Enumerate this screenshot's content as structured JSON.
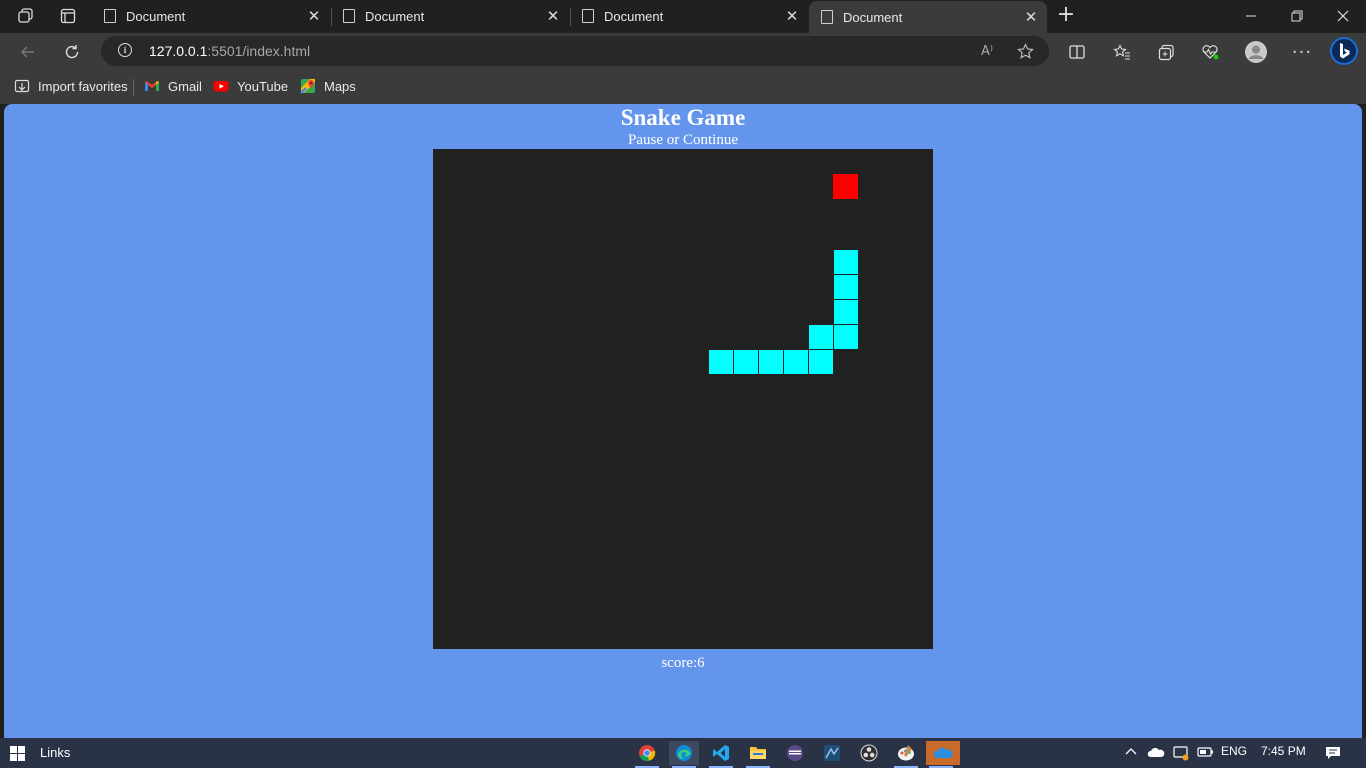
{
  "browser": {
    "tabs": [
      {
        "title": "Document",
        "active": false
      },
      {
        "title": "Document",
        "active": false
      },
      {
        "title": "Document",
        "active": false
      },
      {
        "title": "Document",
        "active": true
      }
    ],
    "url_host": "127.0.0.1",
    "url_path": ":5501/index.html",
    "read_aloud_label": "A⁾",
    "favorites": [
      {
        "label": "Import favorites",
        "icon": "import-icon"
      },
      {
        "label": "Gmail",
        "icon": "gmail-icon"
      },
      {
        "label": "YouTube",
        "icon": "youtube-icon"
      },
      {
        "label": "Maps",
        "icon": "maps-icon"
      }
    ]
  },
  "game": {
    "title": "Snake Game",
    "pause_label": "Pause or Continue",
    "score_text": "score:6",
    "grid_cells": 20,
    "snake": [
      [
        11,
        8
      ],
      [
        12,
        8
      ],
      [
        13,
        8
      ],
      [
        14,
        8
      ],
      [
        15,
        8
      ],
      [
        15,
        7
      ],
      [
        16,
        7
      ],
      [
        16,
        6
      ],
      [
        16,
        5
      ],
      [
        16,
        4
      ]
    ],
    "food": [
      16,
      1
    ],
    "colors": {
      "background": "#6495ed",
      "board": "#212121",
      "snake": "#00ffff",
      "food": "#ff0000"
    }
  },
  "taskbar": {
    "links_label": "Links",
    "apps": [
      "chrome-icon",
      "edge-icon",
      "vscode-icon",
      "file-explorer-icon",
      "app-icon",
      "app-icon",
      "obs-icon",
      "paint-icon",
      "onedrive-icon"
    ],
    "language": "ENG",
    "time": "7:45 PM"
  }
}
